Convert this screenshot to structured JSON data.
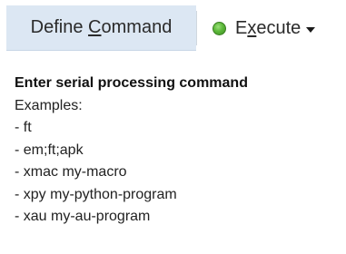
{
  "toolbar": {
    "define_tab": {
      "label_pre": "Define ",
      "label_mnemonic": "C",
      "label_post": "ommand"
    },
    "execute": {
      "label_pre": "E",
      "label_mnemonic": "x",
      "label_post": "ecute",
      "status_icon": "green-status-led",
      "status_color": "#5cb83a",
      "dropdown_icon": "caret-down"
    }
  },
  "panel": {
    "heading": "Enter serial processing command",
    "examples_label": "Examples:",
    "examples": [
      "- ft",
      "- em;ft;apk",
      "- xmac my-macro",
      "- xpy my-python-program",
      "- xau my-au-program"
    ]
  }
}
